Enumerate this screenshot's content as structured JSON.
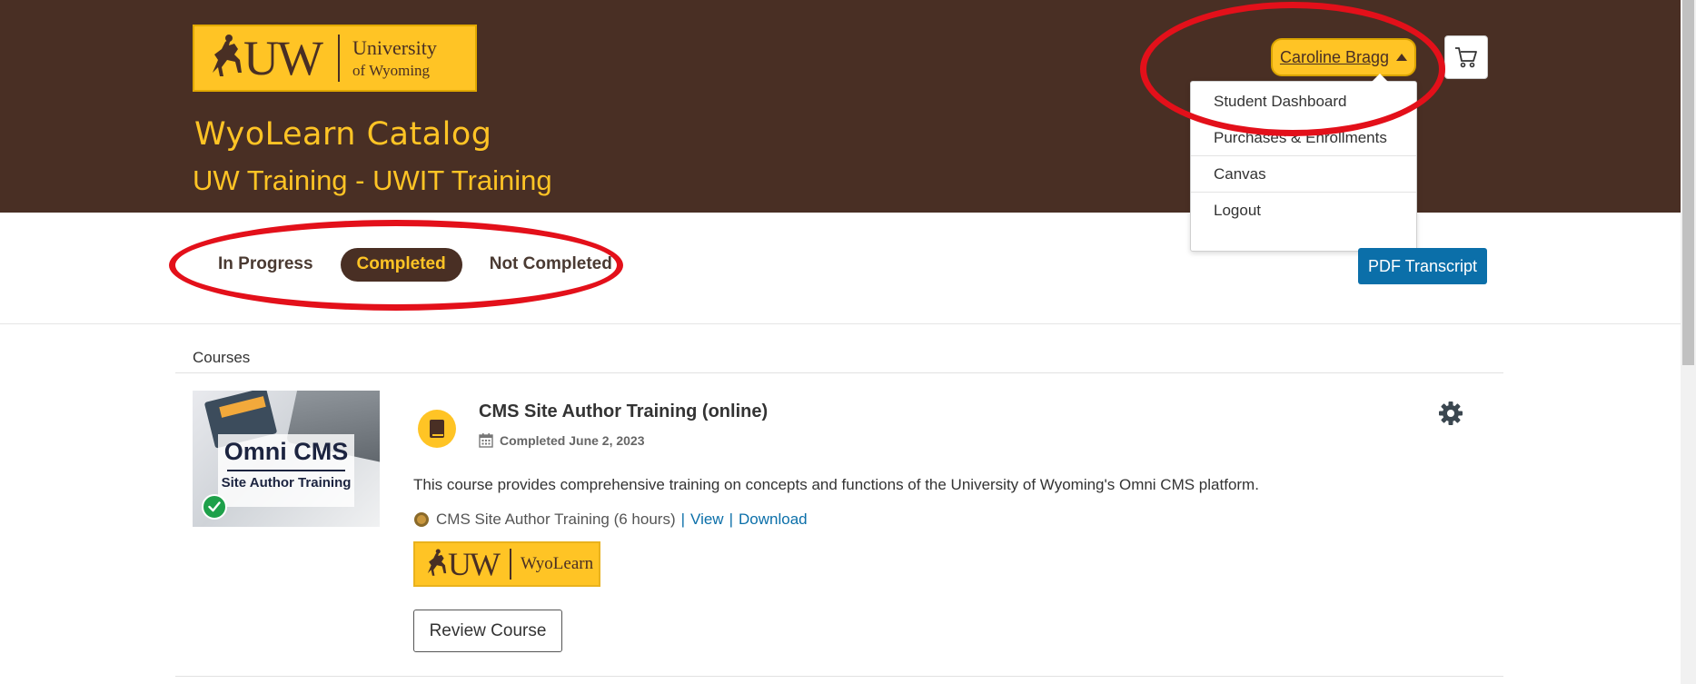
{
  "header": {
    "logo": {
      "mark": "UW",
      "university_line1": "University",
      "university_line2": "of Wyoming"
    },
    "catalog_title": "WyoLearn Catalog",
    "catalog_subtitle": "UW Training - UWIT Training",
    "user_name": "Caroline Bragg",
    "cart_icon": "cart-icon",
    "user_menu": [
      "Student Dashboard",
      "Purchases & Enrollments",
      "Canvas",
      "Logout"
    ]
  },
  "tabs": [
    {
      "label": "In Progress",
      "active": false
    },
    {
      "label": "Completed",
      "active": true
    },
    {
      "label": "Not Completed",
      "active": false
    }
  ],
  "pdf_transcript_label": "PDF Transcript",
  "courses_label": "Courses",
  "course": {
    "thumbnail": {
      "title": "Omni CMS",
      "subtitle": "Site Author Training"
    },
    "title": "CMS Site Author Training (online)",
    "completed": "Completed June 2, 2023",
    "description": "This course provides comprehensive training on concepts and functions of the University of Wyoming's Omni CMS platform.",
    "certificate": {
      "name": "CMS Site Author Training (6 hours)",
      "sep": "|",
      "view_label": "View",
      "download_label": "Download"
    },
    "badge": {
      "mark": "UW",
      "name": "WyoLearn"
    },
    "review_label": "Review Course"
  },
  "colors": {
    "brown": "#492f24",
    "gold": "#ffc425",
    "link_blue": "#0b6fa9",
    "annotation_red": "#e3101a",
    "success_green": "#1ea04a"
  }
}
